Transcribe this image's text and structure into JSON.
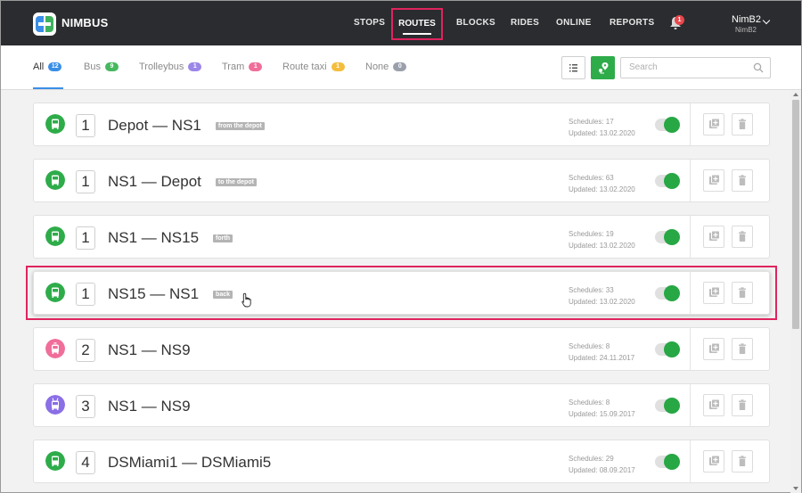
{
  "app": {
    "brand": "NIMBUS"
  },
  "nav": {
    "items": [
      {
        "key": "stops",
        "label": "STOPS"
      },
      {
        "key": "routes",
        "label": "ROUTES",
        "active": true
      },
      {
        "key": "blocks",
        "label": "BLOCKS"
      },
      {
        "key": "rides",
        "label": "RIDES"
      },
      {
        "key": "online",
        "label": "ONLINE"
      },
      {
        "key": "reports",
        "label": "REPORTS"
      }
    ],
    "notifications_count": "1",
    "user": {
      "name": "NimB2",
      "sub": "NimB2"
    }
  },
  "filters": {
    "tabs": [
      {
        "label": "All",
        "count": "12",
        "color": "#3b8ee6",
        "active": true
      },
      {
        "label": "Bus",
        "count": "9",
        "color": "#47b85f"
      },
      {
        "label": "Trolleybus",
        "count": "1",
        "color": "#9b87e8"
      },
      {
        "label": "Tram",
        "count": "1",
        "color": "#f06e9a"
      },
      {
        "label": "Route taxi",
        "count": "1",
        "color": "#f4bd3d"
      },
      {
        "label": "None",
        "count": "0",
        "color": "#9aa0ab"
      }
    ],
    "search_placeholder": "Search"
  },
  "routes": [
    {
      "number": "1",
      "name": "Depot — NS1",
      "tag": "from the depot",
      "type": "bus",
      "icon_color": "#2eac4a",
      "schedules": "Schedules: 17",
      "updated": "Updated: 13.02.2020",
      "enabled": true
    },
    {
      "number": "1",
      "name": "NS1 — Depot",
      "tag": "to the depot",
      "type": "bus",
      "icon_color": "#2eac4a",
      "schedules": "Schedules: 63",
      "updated": "Updated: 13.02.2020",
      "enabled": true
    },
    {
      "number": "1",
      "name": "NS1 — NS15",
      "tag": "forth",
      "type": "bus",
      "icon_color": "#2eac4a",
      "schedules": "Schedules: 19",
      "updated": "Updated: 13.02.2020",
      "enabled": true
    },
    {
      "number": "1",
      "name": "NS15 — NS1",
      "tag": "back",
      "type": "bus",
      "icon_color": "#2eac4a",
      "schedules": "Schedules: 33",
      "updated": "Updated: 13.02.2020",
      "enabled": true,
      "highlighted": true
    },
    {
      "number": "2",
      "name": "NS1 — NS9",
      "tag": "",
      "type": "tram",
      "icon_color": "#f06e9a",
      "schedules": "Schedules: 8",
      "updated": "Updated: 24.11.2017",
      "enabled": true
    },
    {
      "number": "3",
      "name": "NS1 — NS9",
      "tag": "",
      "type": "trolleybus",
      "icon_color": "#8a6fe6",
      "schedules": "Schedules: 8",
      "updated": "Updated: 15.09.2017",
      "enabled": true
    },
    {
      "number": "4",
      "name": "DSMiami1 — DSMiami5",
      "tag": "",
      "type": "bus",
      "icon_color": "#2eac4a",
      "schedules": "Schedules: 29",
      "updated": "Updated: 08.09.2017",
      "enabled": true
    }
  ]
}
